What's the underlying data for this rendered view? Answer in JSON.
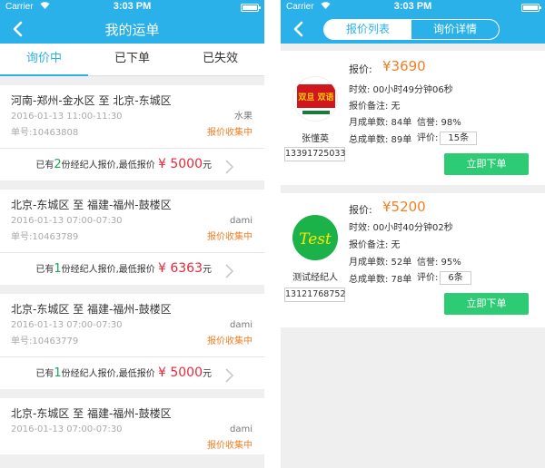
{
  "left": {
    "status": {
      "carrier": "Carrier",
      "time": "3:03 PM"
    },
    "nav": {
      "title": "我的运单"
    },
    "tabs": [
      "询价中",
      "已下单",
      "已失效"
    ],
    "orders": [
      {
        "route": "河南-郑州-金水区 至 北京-东城区",
        "datetime": "2016-01-13 11:00-11:30",
        "cargo": "水果",
        "order_no": "单号:10463808",
        "status": "报价收集中",
        "prefix": "已有",
        "count": "2",
        "mid": "份经纪人报价,最低报价",
        "price": "¥ 5000",
        "unit": "元"
      },
      {
        "route": "北京-东城区 至 福建-福州-鼓楼区",
        "datetime": "2016-01-13 07:00-07:30",
        "cargo": "dami",
        "order_no": "单号:10463789",
        "status": "报价收集中",
        "prefix": "已有",
        "count": "1",
        "mid": "份经纪人报价,最低报价",
        "price": "¥ 6363",
        "unit": "元"
      },
      {
        "route": "北京-东城区 至 福建-福州-鼓楼区",
        "datetime": "2016-01-13 07:00-07:30",
        "cargo": "dami",
        "order_no": "单号:10463779",
        "status": "报价收集中",
        "prefix": "已有",
        "count": "1",
        "mid": "份经纪人报价,最低报价",
        "price": "¥ 5000",
        "unit": "元"
      },
      {
        "route": "北京-东城区 至 福建-福州-鼓楼区",
        "datetime": "2016-01-13 07:00-07:30",
        "cargo": "dami",
        "order_no": "",
        "status": "报价收集中",
        "prefix": "",
        "count": "",
        "mid": "",
        "price": "",
        "unit": ""
      }
    ]
  },
  "right": {
    "status": {
      "carrier": "Carrier",
      "time": "3:03 PM"
    },
    "segments": [
      "报价列表",
      "询价详情"
    ],
    "quotes": [
      {
        "avatar_text": "双旦 双语",
        "name": "张懂英",
        "phone": "13391725033",
        "price_label": "报价:",
        "price": "¥3690",
        "time_limit": "时效: 00小时49分钟06秒",
        "remark": "报价备注: 无",
        "monthly": "月成单数: 84单",
        "credit": "信誉: 98%",
        "total": "总成单数: 89单",
        "eval_label": "评价:",
        "eval": "15条",
        "button": "立即下单"
      },
      {
        "avatar_text": "Test",
        "name": "测试经纪人",
        "phone": "13121768752",
        "price_label": "报价:",
        "price": "¥5200",
        "time_limit": "时效: 00小时40分钟02秒",
        "remark": "报价备注: 无",
        "monthly": "月成单数: 52单",
        "credit": "信誉: 95%",
        "total": "总成单数: 78单",
        "eval_label": "评价:",
        "eval": "6条",
        "button": "立即下单"
      }
    ]
  },
  "colors": {
    "brand": "#2bb1ea",
    "price": "#e8283a",
    "accent_orange": "#f08026",
    "button_green": "#2ecb75",
    "count_green": "#1aa85d"
  },
  "icons": [
    "wifi-icon",
    "battery-icon",
    "back-chevron-icon",
    "chevron-right-icon"
  ]
}
